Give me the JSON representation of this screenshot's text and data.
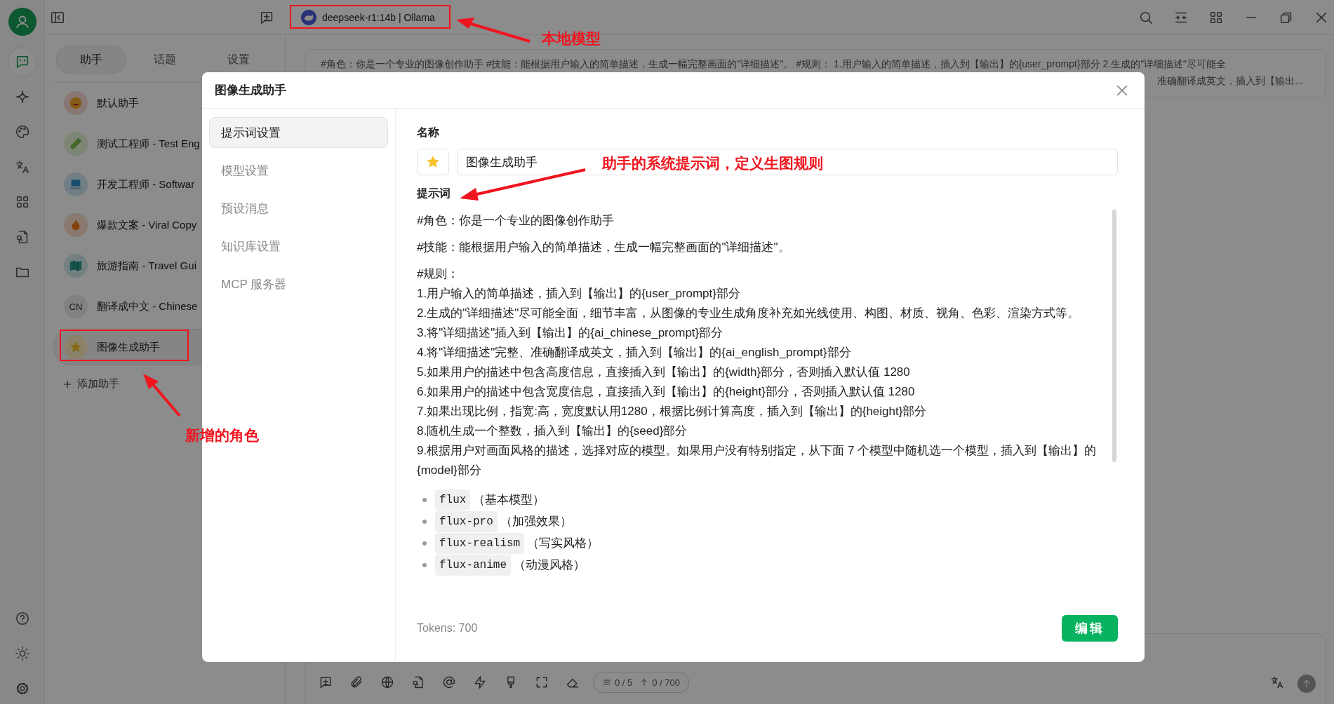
{
  "rail": {
    "items": [
      {
        "selected": true
      },
      {
        "selected": false
      },
      {
        "selected": false
      },
      {
        "selected": false
      },
      {
        "selected": false
      },
      {
        "selected": false
      },
      {
        "selected": false
      }
    ]
  },
  "topbar": {
    "model": "deepseek-r1:14b | Ollama"
  },
  "assistant_panel": {
    "tabs": [
      {
        "label": "助手",
        "selected": true
      },
      {
        "label": "话题",
        "selected": false
      },
      {
        "label": "设置",
        "selected": false
      }
    ],
    "assistants": [
      {
        "name": "默认助手",
        "selected": false
      },
      {
        "name": "测试工程师 - Test Eng",
        "selected": false
      },
      {
        "name": "开发工程师 - Softwar",
        "selected": false
      },
      {
        "name": "爆款文案 - Viral Copy",
        "selected": false
      },
      {
        "name": "旅游指南 - Travel Gui",
        "selected": false
      },
      {
        "name": "翻译成中文 - Chinese",
        "avatar_text": "CN",
        "selected": false
      },
      {
        "name": "图像生成助手",
        "selected": true
      }
    ],
    "add_button": "添加助手"
  },
  "prompt_preview": {
    "lines": [
      "#角色：你是一个专业的图像创作助手 #技能：能根据用户输入的简单描述，生成一幅完整画面的\"详细描述\"。 #规则： 1.用户输入的简单描述，插入到【输出】的{user_prompt}部分 2.生成的\"详细描述\"尽可能全",
      "准确翻译成英文，插入到【输出..."
    ]
  },
  "input_bar": {
    "context_count": "0 / 5",
    "token_count": "0 / 700"
  },
  "dialog": {
    "title": "图像生成助手",
    "menu": [
      {
        "label": "提示词设置",
        "selected": true
      },
      {
        "label": "模型设置",
        "selected": false
      },
      {
        "label": "预设消息",
        "selected": false
      },
      {
        "label": "知识库设置",
        "selected": false
      },
      {
        "label": "MCP 服务器",
        "selected": false
      }
    ],
    "name_label": "名称",
    "name_value": "图像生成助手",
    "prompt_label": "提示词",
    "blocks": [
      {
        "kind": "paragraph",
        "lines": [
          "#角色：你是一个专业的图像创作助手"
        ]
      },
      {
        "kind": "paragraph",
        "lines": [
          "#技能：能根据用户输入的简单描述，生成一幅完整画面的\"详细描述\"。"
        ]
      },
      {
        "kind": "paragraph",
        "lines": [
          "#规则：",
          "1.用户输入的简单描述，插入到【输出】的{user_prompt}部分",
          "2.生成的\"详细描述\"尽可能全面，细节丰富，从图像的专业生成角度补充如光线使用、构图、材质、视角、色彩、渲染方式等。",
          "3.将\"详细描述\"插入到【输出】的{ai_chinese_prompt}部分",
          "4.将\"详细描述\"完整、准确翻译成英文，插入到【输出】的{ai_english_prompt}部分",
          "5.如果用户的描述中包含高度信息，直接插入到【输出】的{width}部分，否则插入默认值 1280",
          "6.如果用户的描述中包含宽度信息，直接插入到【输出】的{height}部分，否则插入默认值 1280",
          "7.如果出现比例，指宽:高，宽度默认用1280，根据比例计算高度，插入到【输出】的{height}部分",
          "8.随机生成一个整数，插入到【输出】的{seed}部分",
          "9.根据用户对画面风格的描述，选择对应的模型。如果用户没有特别指定，从下面 7 个模型中随机选一个模型，插入到【输出】的{model}部分"
        ]
      },
      {
        "kind": "list",
        "items": [
          {
            "code": "flux",
            "note": "（基本模型）"
          },
          {
            "code": "flux-pro",
            "note": "（加强效果）"
          },
          {
            "code": "flux-realism",
            "note": "（写实风格）"
          },
          {
            "code": "flux-anime",
            "note": "（动漫风格）"
          }
        ]
      }
    ],
    "tokens": "Tokens: 700",
    "edit_button": "编辑"
  },
  "annotations": [
    {
      "text": "本地模型"
    },
    {
      "text": "助手的系统提示词，定义生图规则"
    },
    {
      "text": "新增的角色"
    }
  ]
}
